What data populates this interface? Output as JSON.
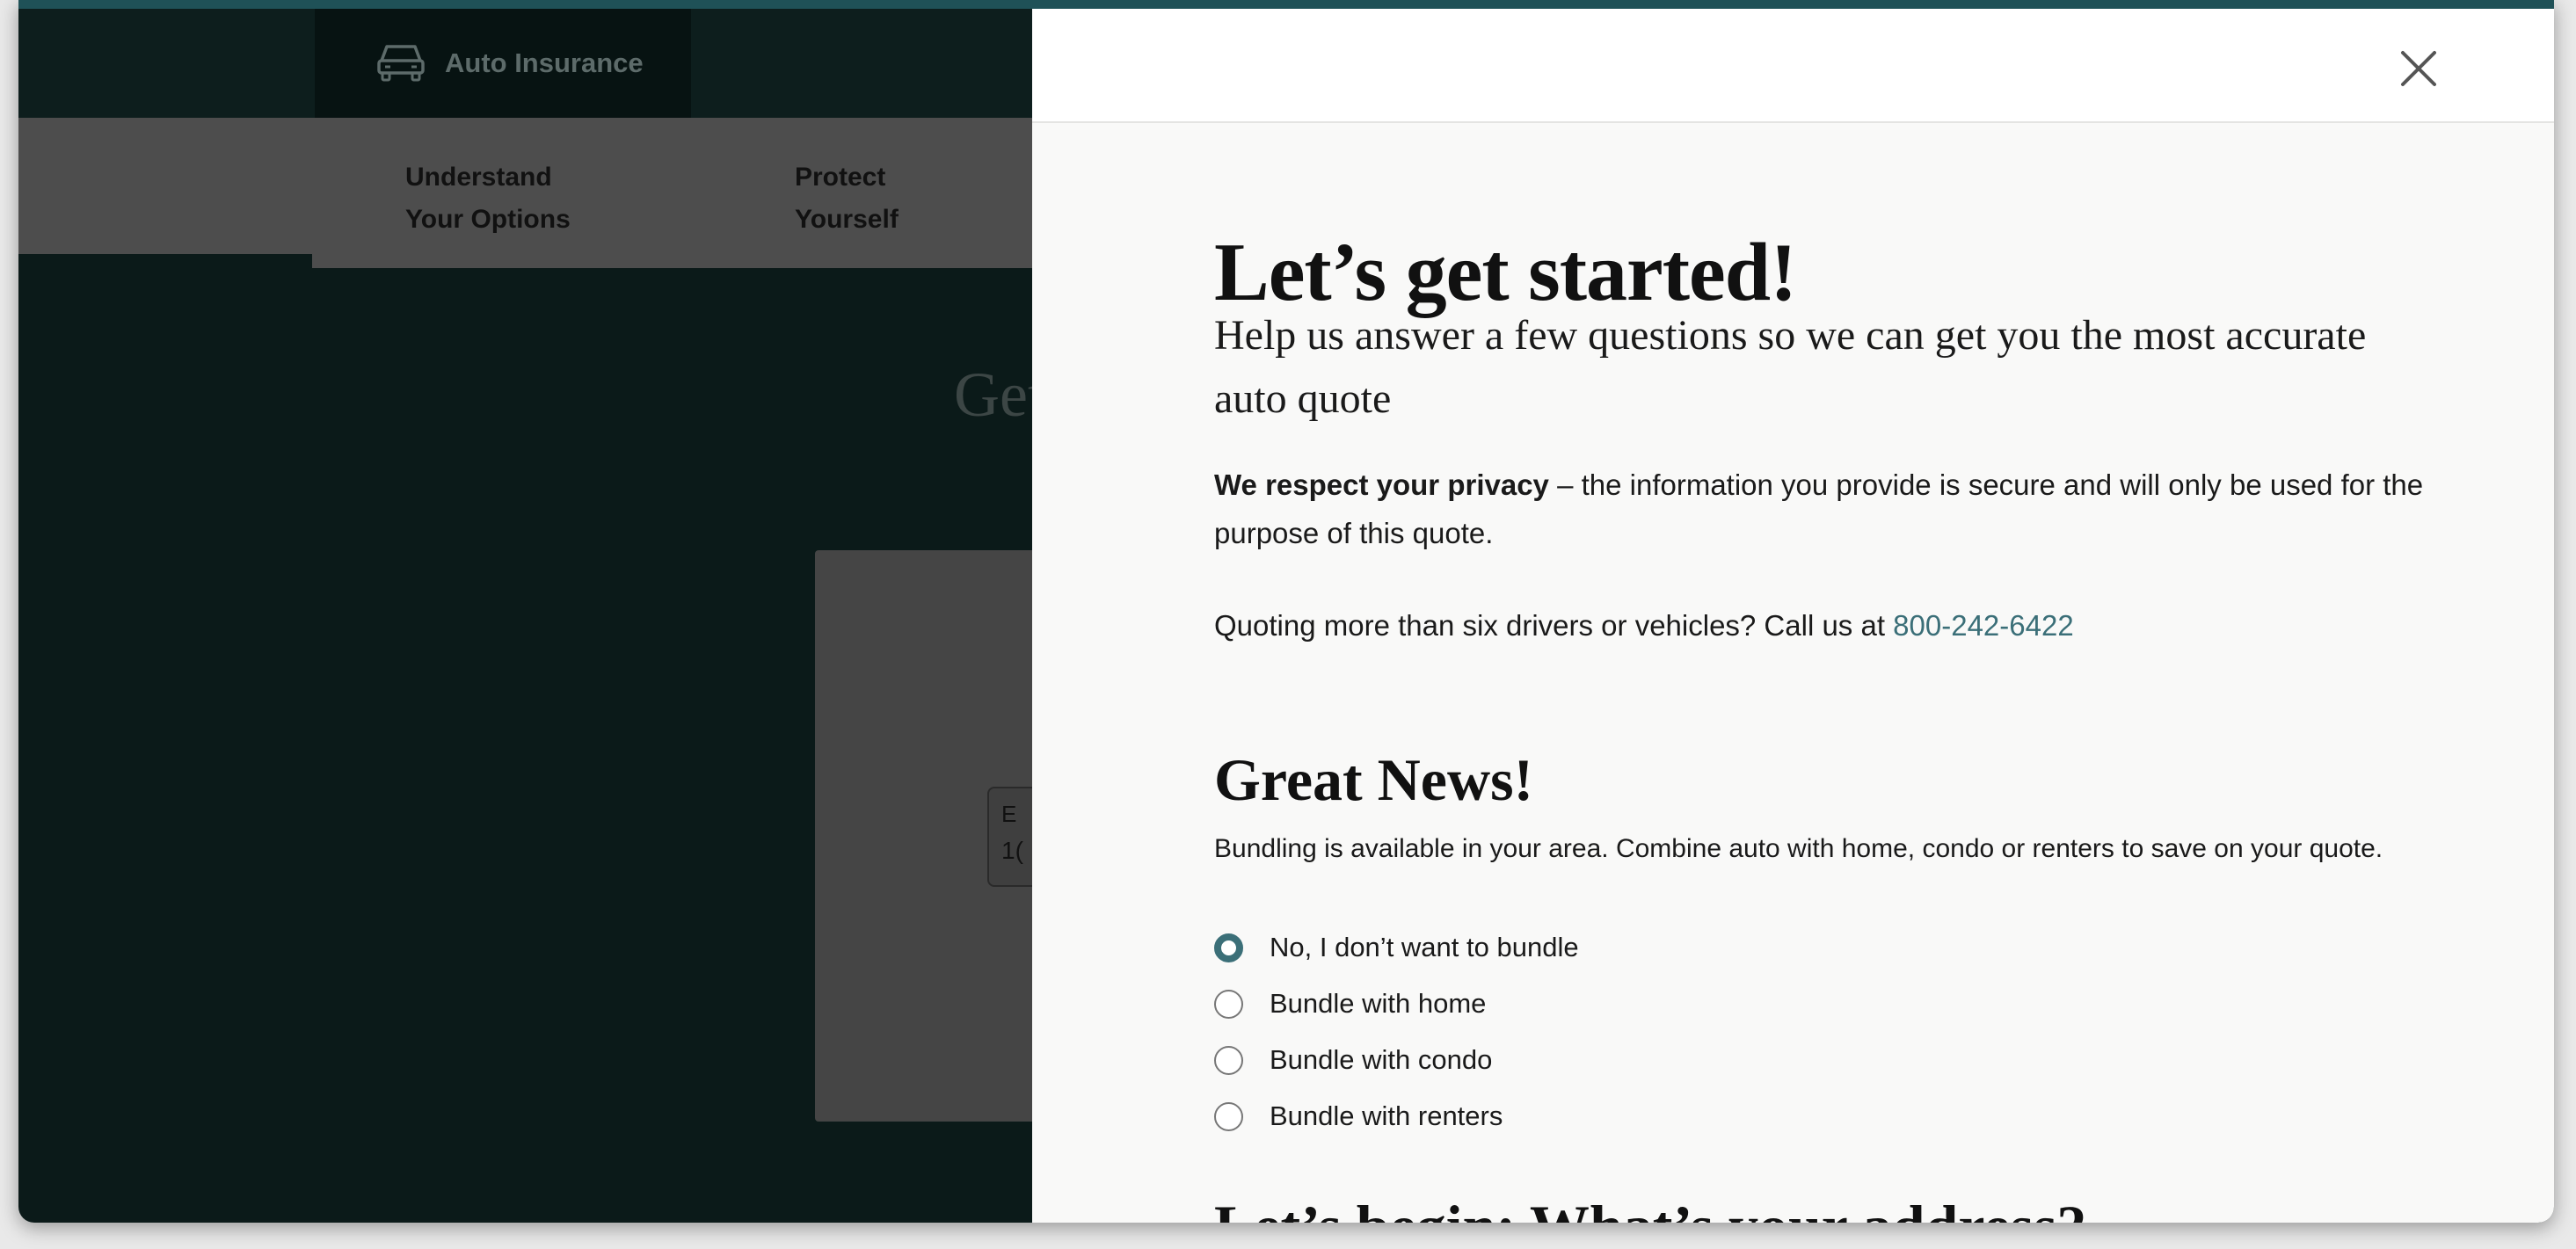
{
  "background": {
    "tab_label": "Auto Insurance",
    "subnav": [
      {
        "line1": "Understand",
        "line2": "Your Options"
      },
      {
        "line1": "Protect",
        "line2": "Yourself"
      }
    ],
    "heading_fragment": "Get",
    "input_label_fragment": "E",
    "input_value_fragment": "1("
  },
  "modal": {
    "title": "Let’s get started!",
    "subtitle": "Help us answer a few questions so we can get you the most accurate auto quote",
    "privacy_bold": "We respect your privacy",
    "privacy_rest": " – the information you provide is secure and will only be used for the purpose of this quote.",
    "quoting_text": "Quoting more than six drivers or vehicles? Call us at ",
    "phone": "800-242-6422",
    "news_title": "Great News!",
    "news_text": "Bundling is available in your area. Combine auto with home, condo or renters to save on your quote.",
    "bundle_options": [
      {
        "label": "No, I don’t want to bundle",
        "selected": true
      },
      {
        "label": "Bundle with home",
        "selected": false
      },
      {
        "label": "Bundle with condo",
        "selected": false
      },
      {
        "label": "Bundle with renters",
        "selected": false
      }
    ],
    "address_title": "Let’s begin: What’s your address?"
  },
  "colors": {
    "accent": "#3b6f78",
    "topbar": "#1f5157",
    "overlay_dark": "#0b1a19"
  },
  "icons": {
    "tab_icon": "car-icon",
    "close": "close-icon"
  }
}
